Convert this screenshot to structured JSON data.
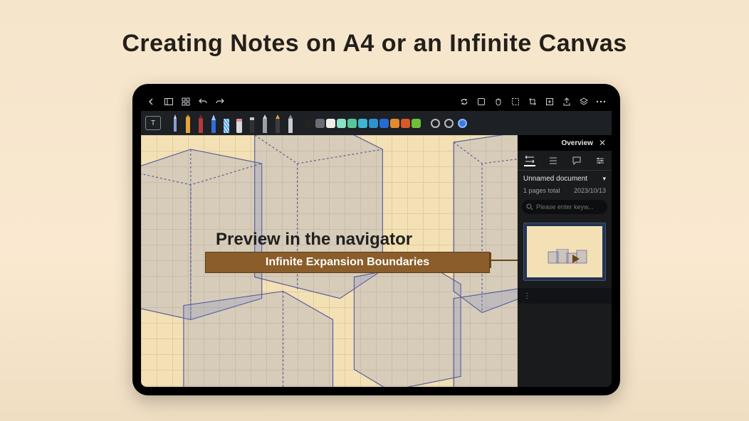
{
  "page_title": "Creating Notes on A4 or an Infinite Canvas",
  "top_toolbar_icons": {
    "back": "back",
    "panel": "panel-layout",
    "grid_menu": "grid-menu",
    "undo": "undo",
    "redo": "redo",
    "sync": "sync",
    "shape": "shape",
    "hand": "hand",
    "select": "select",
    "crop": "crop",
    "insert": "insert",
    "share": "share",
    "layers": "layers",
    "more": "more"
  },
  "tool_row": {
    "text_tool_label": "T"
  },
  "swatch_colors": [
    "#222222",
    "#6a6e73",
    "#f0eee6",
    "#8be0c6",
    "#57c79a",
    "#3fb4d4",
    "#2e93cc",
    "#256bd0",
    "#e48a2e",
    "#d75a2a",
    "#6fbf3a"
  ],
  "canvas": {
    "preview_title": "Preview in the navigator",
    "sub_banner": "Infinite Expansion Boundaries"
  },
  "overview": {
    "title": "Overview",
    "doc_name": "Unnamed document",
    "pages_count": "1 pages total",
    "date": "2023/10/13",
    "search_placeholder": "Please enter keyw..."
  }
}
